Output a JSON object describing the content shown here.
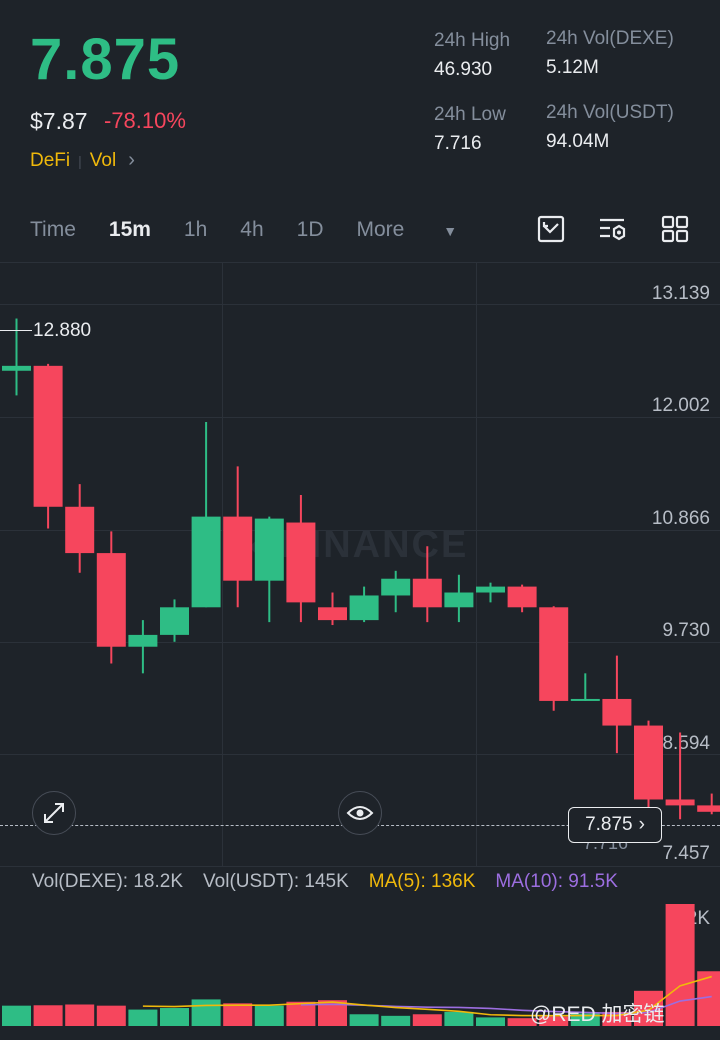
{
  "ticker": {
    "price": "7.875",
    "usd_price": "$7.87",
    "change_pct": "-78.10%",
    "tags": [
      "DeFi",
      "Vol"
    ],
    "colors": {
      "up": "#2ebd85",
      "down": "#f6465d",
      "accent": "#f0b90b",
      "ma5": "#f0b90b",
      "ma10": "#9c6ee0"
    }
  },
  "stats": {
    "high_label": "24h High",
    "high_value": "46.930",
    "low_label": "24h Low",
    "low_value": "7.716",
    "vol_base_label": "24h Vol(DEXE)",
    "vol_base_value": "5.12M",
    "vol_quote_label": "24h Vol(USDT)",
    "vol_quote_value": "94.04M"
  },
  "timeframes": {
    "items": [
      "Time",
      "15m",
      "1h",
      "4h",
      "1D",
      "More"
    ],
    "active": "15m",
    "icons": [
      "chart-style-icon",
      "indicator-settings-icon",
      "grid-layout-icon"
    ]
  },
  "chart": {
    "price_axis": [
      "13.139",
      "12.002",
      "10.866",
      "9.730",
      "8.594",
      "7.457"
    ],
    "high_marker": "12.880",
    "low_marker": "7.716",
    "last_price_tag": "7.875",
    "watermark": "BINANCE",
    "icons": [
      "expand-icon",
      "eye-icon"
    ]
  },
  "chart_data": {
    "type": "candlestick",
    "ylim": [
      7.2,
      13.35
    ],
    "candles": [
      {
        "o": 12.35,
        "h": 12.88,
        "l": 12.1,
        "c": 12.4
      },
      {
        "o": 12.4,
        "h": 12.42,
        "l": 10.75,
        "c": 10.97
      },
      {
        "o": 10.97,
        "h": 11.2,
        "l": 10.3,
        "c": 10.5
      },
      {
        "o": 10.5,
        "h": 10.72,
        "l": 9.38,
        "c": 9.55
      },
      {
        "o": 9.55,
        "h": 9.82,
        "l": 9.28,
        "c": 9.67
      },
      {
        "o": 9.67,
        "h": 10.03,
        "l": 9.6,
        "c": 9.95
      },
      {
        "o": 9.95,
        "h": 11.83,
        "l": 9.95,
        "c": 10.87
      },
      {
        "o": 10.87,
        "h": 11.38,
        "l": 9.95,
        "c": 10.22
      },
      {
        "o": 10.22,
        "h": 10.87,
        "l": 9.8,
        "c": 10.85
      },
      {
        "o": 10.81,
        "h": 11.09,
        "l": 9.8,
        "c": 10.0
      },
      {
        "o": 9.95,
        "h": 10.1,
        "l": 9.77,
        "c": 9.82
      },
      {
        "o": 9.82,
        "h": 10.16,
        "l": 9.8,
        "c": 10.07
      },
      {
        "o": 10.07,
        "h": 10.32,
        "l": 9.9,
        "c": 10.24
      },
      {
        "o": 10.24,
        "h": 10.57,
        "l": 9.8,
        "c": 9.95
      },
      {
        "o": 9.95,
        "h": 10.28,
        "l": 9.8,
        "c": 10.1
      },
      {
        "o": 10.1,
        "h": 10.2,
        "l": 10.0,
        "c": 10.16
      },
      {
        "o": 10.16,
        "h": 10.18,
        "l": 9.9,
        "c": 9.95
      },
      {
        "o": 9.95,
        "h": 9.96,
        "l": 8.9,
        "c": 9.0
      },
      {
        "o": 9.0,
        "h": 9.28,
        "l": 9.0,
        "c": 9.02
      },
      {
        "o": 9.02,
        "h": 9.46,
        "l": 8.47,
        "c": 8.75
      },
      {
        "o": 8.75,
        "h": 8.8,
        "l": 7.92,
        "c": 8.0
      },
      {
        "o": 8.0,
        "h": 8.68,
        "l": 7.8,
        "c": 7.94
      },
      {
        "o": 7.94,
        "h": 8.06,
        "l": 7.85,
        "c": 7.875
      }
    ],
    "volume": {
      "labels": {
        "base": "Vol(DEXE): 18.2K",
        "quote": "Vol(USDT): 145K",
        "ma5": "MA(5): 136K",
        "ma10": "MA(10): 91.5K"
      },
      "axis_max_label": "312K",
      "max": 312,
      "values": [
        52,
        53,
        55,
        52,
        42,
        46,
        68,
        58,
        52,
        62,
        66,
        30,
        26,
        30,
        36,
        22,
        20,
        24,
        32,
        36,
        90,
        312,
        140
      ],
      "ma5": [
        null,
        null,
        null,
        null,
        50.8,
        49.6,
        52.6,
        53.2,
        53.2,
        57.2,
        61.2,
        53.6,
        47.2,
        42.8,
        37.6,
        28.8,
        26.8,
        26.4,
        26.8,
        26.8,
        40.4,
        102.8,
        126.4
      ],
      "ma10": [
        null,
        null,
        null,
        null,
        null,
        null,
        null,
        null,
        null,
        54.0,
        55.4,
        53.1,
        50.2,
        48.0,
        47.4,
        45.0,
        40.2,
        36.8,
        34.8,
        32.2,
        34.6,
        63.8,
        75.2
      ]
    }
  },
  "footer_watermark": "@RED 加密链"
}
